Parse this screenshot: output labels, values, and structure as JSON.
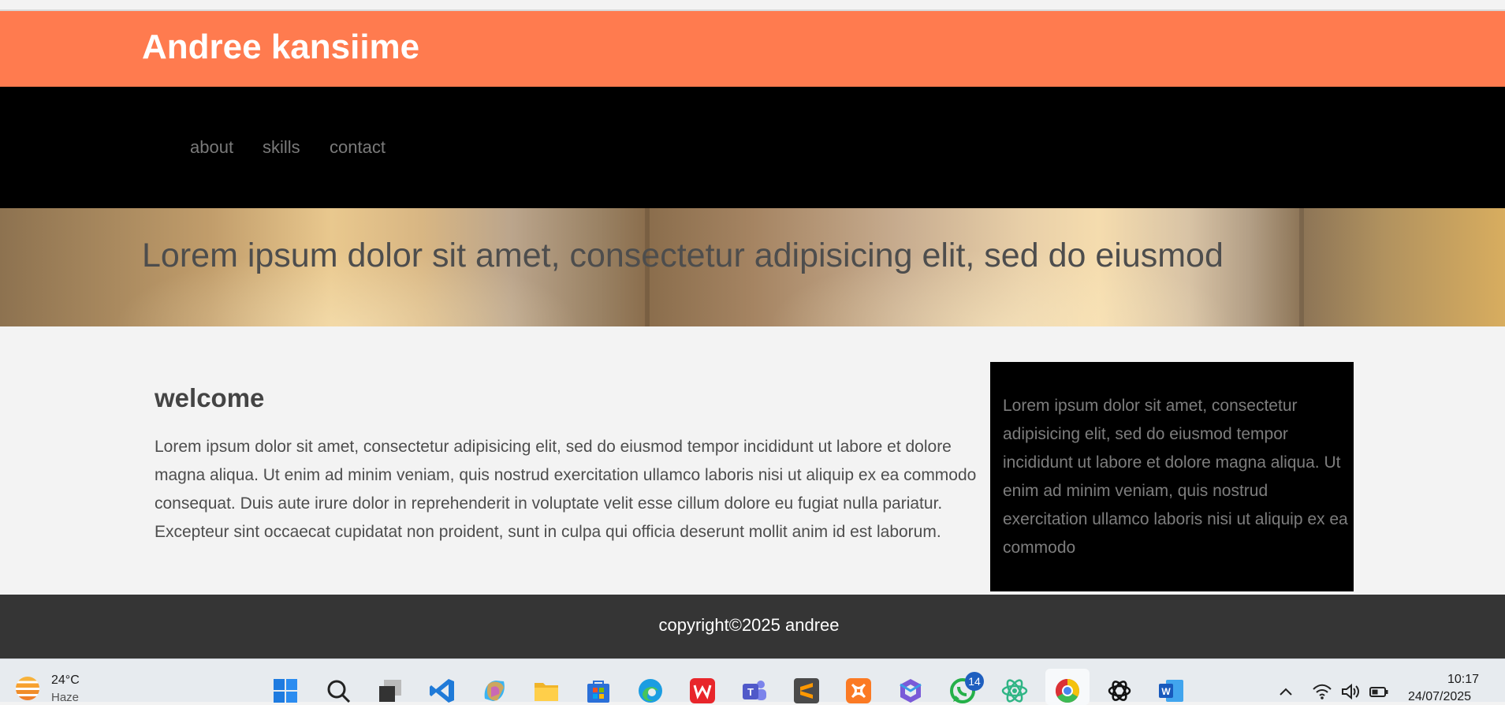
{
  "header": {
    "title": "Andree kansiime",
    "bg_color": "#ff7b4f"
  },
  "nav": {
    "items": [
      {
        "label": "about"
      },
      {
        "label": "skills"
      },
      {
        "label": "contact"
      }
    ]
  },
  "banner": {
    "text": "Lorem ipsum dolor sit amet, consectetur adipisicing elit, sed do eiusmod"
  },
  "main": {
    "heading": "welcome",
    "paragraph": "Lorem ipsum dolor sit amet, consectetur adipisicing elit, sed do eiusmod tempor incididunt ut labore et dolore magna aliqua. Ut enim ad minim veniam, quis nostrud exercitation ullamco laboris nisi ut aliquip ex ea commodo consequat. Duis aute irure dolor in reprehenderit in voluptate velit esse cillum dolore eu fugiat nulla pariatur. Excepteur sint occaecat cupidatat non proident, sunt in culpa qui officia deserunt mollit anim id est laborum."
  },
  "sidebar": {
    "text": "Lorem ipsum dolor sit amet, consectetur adipisicing elit, sed do eiusmod tempor incididunt ut labore et dolore magna aliqua. Ut enim ad minim veniam, quis nostrud exercitation ullamco laboris nisi ut aliquip ex ea commodo"
  },
  "footer": {
    "copyright": "copyright©2025 andree"
  },
  "taskbar": {
    "weather": {
      "temp": "24°C",
      "condition": "Haze",
      "icon": "weather-haze-icon"
    },
    "apps": [
      "windows-start-icon",
      "search-icon",
      "task-view-icon",
      "vscode-icon",
      "copilot-icon",
      "file-explorer-icon",
      "microsoft-store-icon",
      "edge-icon",
      "wps-office-icon",
      "teams-icon",
      "sublime-text-icon",
      "xampp-icon",
      "microsoft-365-icon",
      "whatsapp-icon",
      "atom-icon",
      "chrome-icon",
      "chatgpt-icon",
      "word-icon"
    ],
    "whatsapp_badge": "14",
    "tray": [
      "chevron-up-icon",
      "wifi-icon",
      "volume-icon",
      "battery-icon"
    ],
    "time": "10:17",
    "date": "24/07/2025"
  }
}
